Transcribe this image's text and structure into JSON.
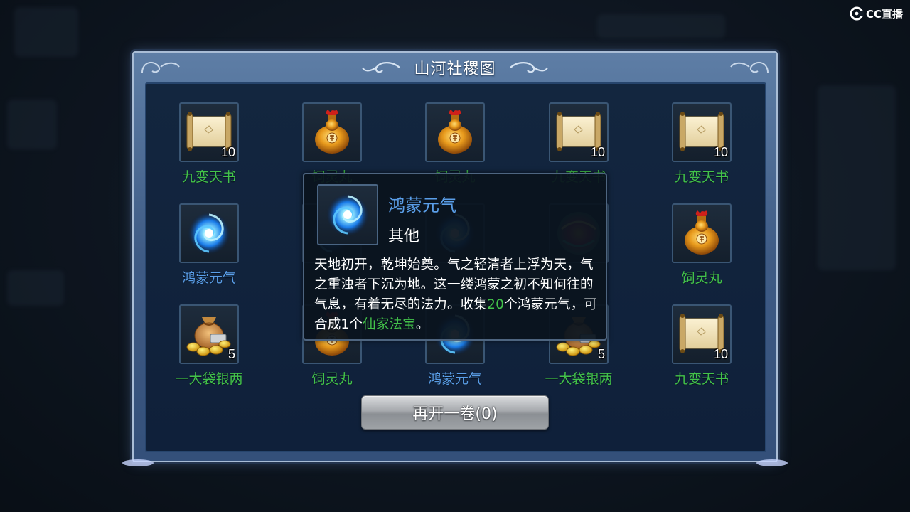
{
  "watermark": {
    "text": "CC直播"
  },
  "panel": {
    "title": "山河社稷图"
  },
  "rewards": [
    {
      "name": "九变天书",
      "qty": "10",
      "icon": "scroll-icon",
      "name_color": "green"
    },
    {
      "name": "饲灵丸",
      "qty": "",
      "icon": "elixir-gourd-icon",
      "name_color": "green"
    },
    {
      "name": "饲灵丸",
      "qty": "",
      "icon": "elixir-gourd-icon",
      "name_color": "green"
    },
    {
      "name": "九变天书",
      "qty": "10",
      "icon": "scroll-icon",
      "name_color": "green"
    },
    {
      "name": "九变天书",
      "qty": "10",
      "icon": "scroll-icon",
      "name_color": "green"
    },
    {
      "name": "鸿蒙元气",
      "qty": "",
      "icon": "blue-vortex-icon",
      "name_color": "blue"
    },
    {
      "name": "",
      "qty": "",
      "icon": "blue-vortex-icon",
      "name_color": "blue"
    },
    {
      "name": "",
      "qty": "",
      "icon": "blue-vortex-icon",
      "name_color": "blue"
    },
    {
      "name": "",
      "qty": "",
      "icon": "colorful-orb-icon",
      "name_color": "green"
    },
    {
      "name": "饲灵丸",
      "qty": "",
      "icon": "elixir-gourd-icon",
      "name_color": "green"
    },
    {
      "name": "一大袋银两",
      "qty": "5",
      "icon": "money-bag-icon",
      "name_color": "green"
    },
    {
      "name": "饲灵丸",
      "qty": "",
      "icon": "elixir-gourd-icon",
      "name_color": "green"
    },
    {
      "name": "鸿蒙元气",
      "qty": "",
      "icon": "blue-vortex-icon",
      "name_color": "blue"
    },
    {
      "name": "一大袋银两",
      "qty": "5",
      "icon": "money-bag-icon",
      "name_color": "green"
    },
    {
      "name": "九变天书",
      "qty": "10",
      "icon": "scroll-icon",
      "name_color": "green"
    }
  ],
  "tooltip": {
    "name": "鸿蒙元气",
    "category": "其他",
    "icon": "blue-vortex-icon",
    "desc_main": "天地初开，乾坤始奠。气之轻清者上浮为天，气之重浊者下沉为地。这一缕鸿蒙之初不知何往的气息，有着无尽的法力。收集",
    "desc_count": "20",
    "desc_mid": "个鸿蒙元气，可合成1个",
    "desc_item": "仙家法宝",
    "desc_end": "。"
  },
  "open_button": {
    "label": "再开一卷(0)"
  },
  "colors": {
    "green_text": "#43c24a",
    "blue_text": "#5a9ee8",
    "frame": "#3e5b85"
  }
}
